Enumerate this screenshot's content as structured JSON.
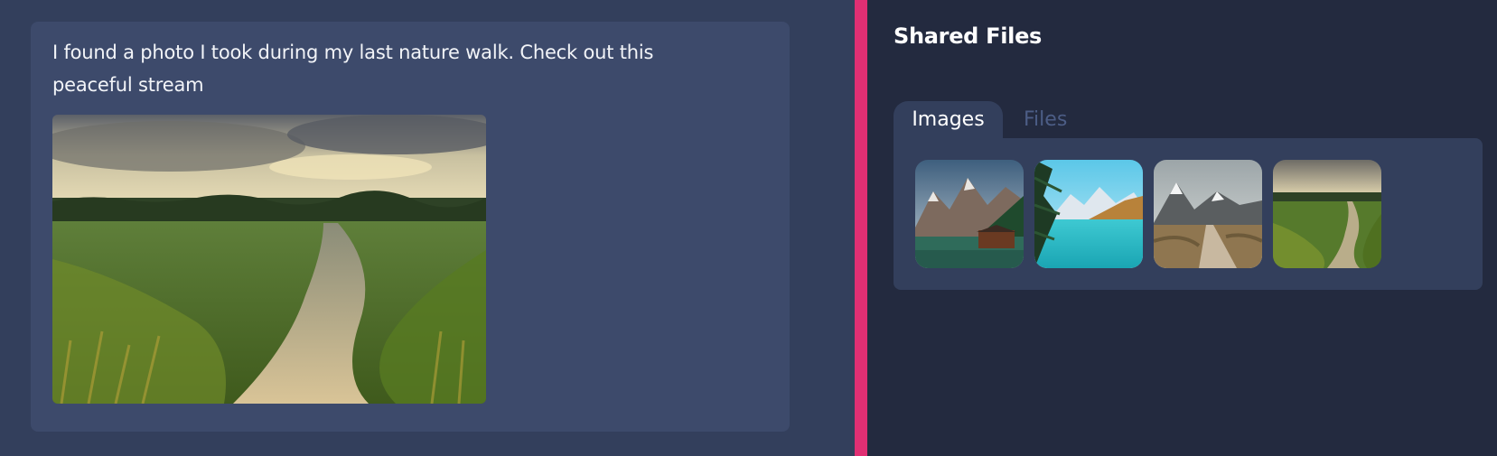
{
  "chat": {
    "message_text": "I found a photo I took during my last nature walk. Check out this peaceful stream"
  },
  "shared_files": {
    "title": "Shared Files",
    "tabs": [
      {
        "label": "Images",
        "active": true
      },
      {
        "label": "Files",
        "active": false
      }
    ],
    "images": [
      {
        "name": "mountain-lake-boathouse"
      },
      {
        "name": "turquoise-mountain-lake"
      },
      {
        "name": "boardwalk-mountain-trail"
      },
      {
        "name": "meadow-stream"
      }
    ]
  },
  "colors": {
    "background": "#333f5c",
    "bubble": "#3d4a6b",
    "panel": "#232a3f",
    "accent": "#e02f73",
    "inactive_tab": "#4c5d86"
  }
}
